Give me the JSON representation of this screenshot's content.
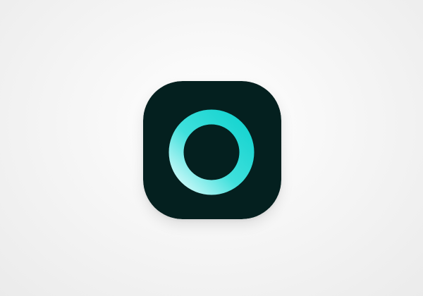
{
  "app_icon": {
    "icon": "ring-logo-icon",
    "colors": {
      "background": "#04201f",
      "ring_gradient_start": "#12d3cf",
      "ring_gradient_mid": "#3fe0dc",
      "ring_gradient_end": "#d9fbfb"
    }
  }
}
